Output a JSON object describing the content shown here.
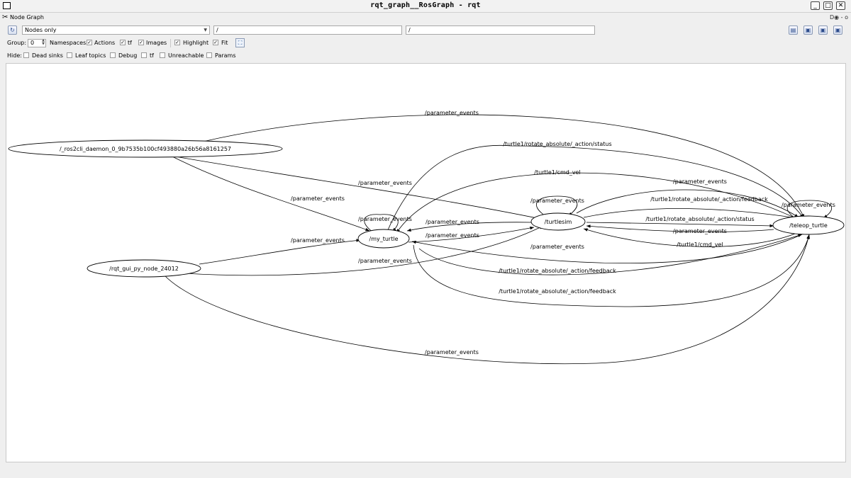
{
  "window": {
    "title": "rqt_graph__RosGraph - rqt",
    "minimize_glyph": "_",
    "maximize_glyph": "□",
    "close_glyph": "✕"
  },
  "plugin": {
    "title": "Node Graph",
    "icon": "wrench-icon",
    "controls": "D◉ - o"
  },
  "toolbar": {
    "refresh_icon": "refresh-icon",
    "graph_mode": "Nodes only",
    "node_filter": "/",
    "topic_filter": "/",
    "save_icons": [
      "load-dot-icon",
      "save-dot-icon",
      "save-svg-icon",
      "save-image-icon"
    ]
  },
  "options": {
    "group_label": "Group:",
    "group_value": "0",
    "namespaces": {
      "label": "Namespaces",
      "checked": false
    },
    "actions": {
      "label": "Actions",
      "checked": true
    },
    "tf": {
      "label": "tf",
      "checked": true
    },
    "images": {
      "label": "Images",
      "checked": true
    },
    "highlight": {
      "label": "Highlight",
      "checked": true
    },
    "fit": {
      "label": "Fit",
      "checked": true
    }
  },
  "hide": {
    "label": "Hide:",
    "dead_sinks": "Dead sinks",
    "leaf_topics": "Leaf topics",
    "debug": "Debug",
    "tf": "tf",
    "unreachable": "Unreachable",
    "params": "Params"
  },
  "graph": {
    "nodes": {
      "daemon": "/_ros2cli_daemon_0_9b7535b100cf493880a26b56a8161257",
      "my_turtle": "/my_turtle",
      "turtlesim": "/turtlesim",
      "teleop": "/teleop_turtle",
      "rqt_gui": "/rqt_gui_py_node_24012"
    },
    "edge_labels": {
      "e1": "/parameter_events",
      "e2": "/turtle1/rotate_absolute/_action/status",
      "e3": "/turtle1/cmd_vel",
      "e4": "/parameter_events",
      "e5": "/parameter_events",
      "e6": "/parameter_events",
      "e7": "/turtle1/rotate_absolute/_action/feedback",
      "e8": "/parameter_events",
      "e9": "/parameter_events",
      "e10": "/parameter_events",
      "e11": "/turtle1/rotate_absolute/_action/status",
      "e12": "/parameter_events",
      "e13": "/parameter_events",
      "e14": "/parameter_events",
      "e15": "/turtle1/cmd_vel",
      "e16": "/parameter_events",
      "e17": "/parameter_events",
      "e18": "/parameter_events",
      "e19": "/turtle1/rotate_absolute/_action/feedback",
      "e20": "/parameter_events"
    }
  }
}
